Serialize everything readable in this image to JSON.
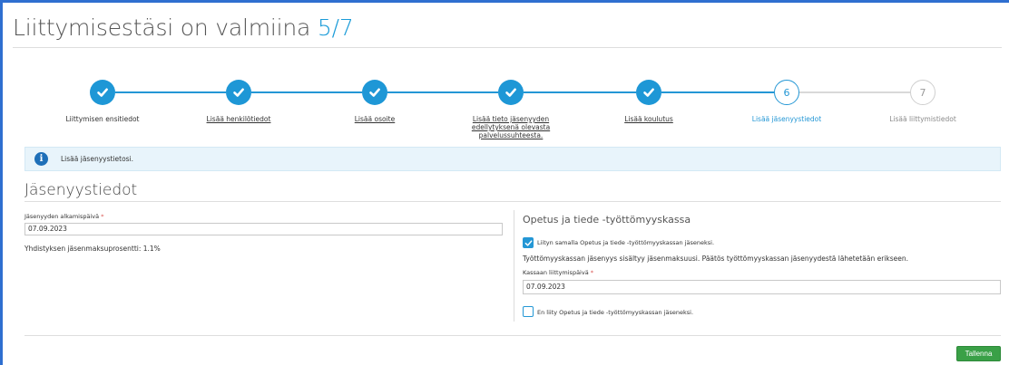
{
  "header": {
    "title": "Liittymisestäsi on valmiina",
    "progress": "5/7"
  },
  "stepper": {
    "steps": [
      {
        "number": "1",
        "label": "Liittymisen ensitiedot",
        "state": "done"
      },
      {
        "number": "2",
        "label": "Lisää henkilötiedot",
        "state": "done"
      },
      {
        "number": "3",
        "label": "Lisää osoite",
        "state": "done"
      },
      {
        "number": "4",
        "label": "Lisää tieto jäsenyyden edellytyksenä olevasta palvelussuhteesta.",
        "state": "done"
      },
      {
        "number": "5",
        "label": "Lisää koulutus",
        "state": "done"
      },
      {
        "number": "6",
        "label": "Lisää jäsenyystiedot",
        "state": "active"
      },
      {
        "number": "7",
        "label": "Lisää liittymistiedot",
        "state": "todo"
      }
    ]
  },
  "alert": {
    "text": "Lisää jäsenyystietosi.",
    "icon": "info-icon"
  },
  "section": {
    "title": "Jäsenyystiedot"
  },
  "left_form": {
    "start_date_label": "Jäsenyyden alkamispäivä",
    "required_mark": "*",
    "start_date_value": "07.09.2023",
    "fee_text": "Yhdistyksen jäsenmaksuprosentti: 1.1%"
  },
  "right_form": {
    "title": "Opetus ja tiede -työttömyyskassa",
    "join_checkbox_label": "Liityn samalla Opetus ja tiede -työttömyyskassan jäseneksi.",
    "join_checked": true,
    "info_text": "Työttömyyskassan jäsenyys sisältyy jäsenmaksuusi. Päätös työttömyyskassan jäsenyydestä lähetetään erikseen.",
    "join_date_label": "Kassaan liittymispäivä",
    "required_mark": "*",
    "join_date_value": "07.09.2023",
    "decline_checkbox_label": "En liity Opetus ja tiede -työttömyyskassan jäseneksi.",
    "decline_checked": false
  },
  "footer": {
    "save_label": "Tallenna"
  },
  "colors": {
    "accent": "#1e97d6",
    "save": "#3aa047",
    "alert_bg": "#e8f4fb"
  }
}
